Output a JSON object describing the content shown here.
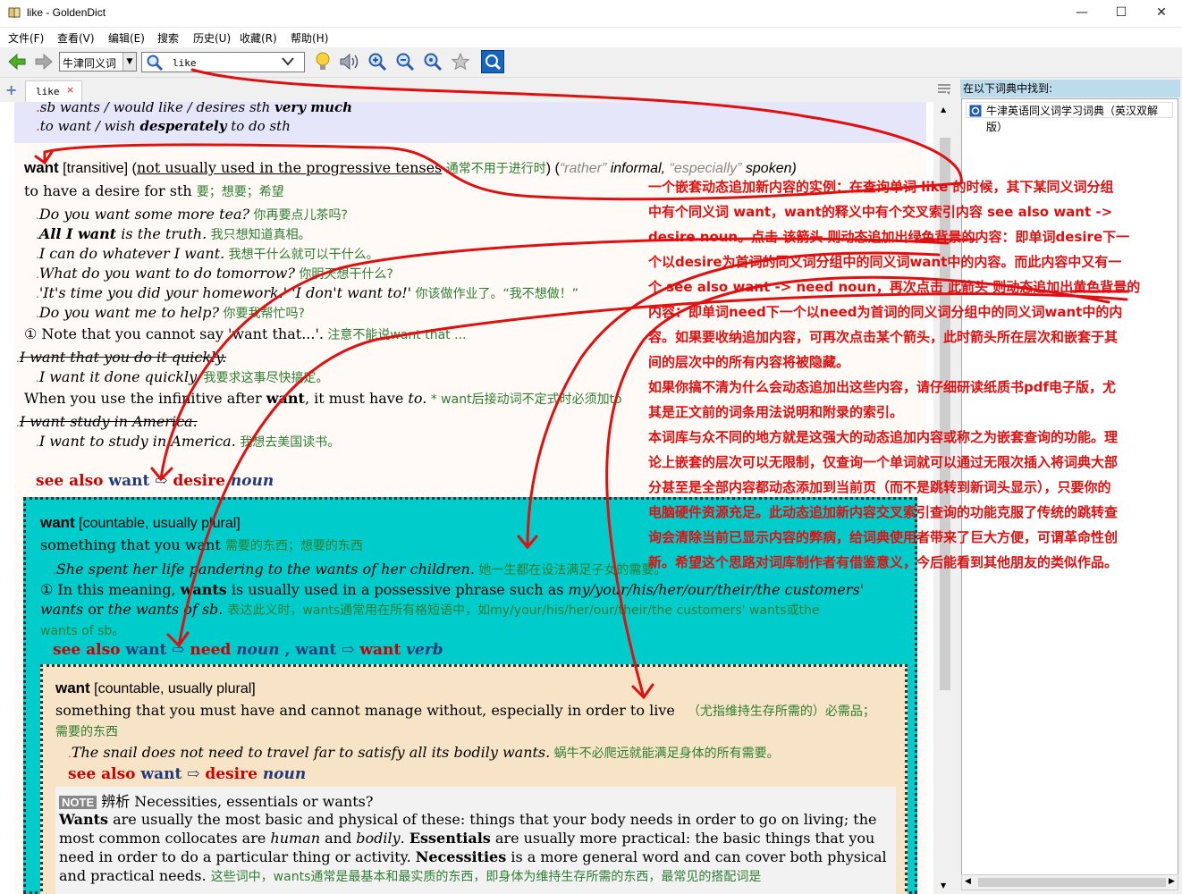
{
  "window": {
    "title": "like - GoldenDict",
    "minimize": "—",
    "maximize": "☐",
    "close": "✕"
  },
  "menu": [
    "文件(F)",
    "查看(V)",
    "编辑(E)",
    "搜索",
    "历史(U)",
    "收藏(R)",
    "帮助(H)"
  ],
  "toolbar": {
    "group": "牛津同义词",
    "query": "like"
  },
  "tab": {
    "label": "like",
    "close": "×"
  },
  "dock": {
    "header": "在以下词典中找到:",
    "dict": "牛津英语同义词学习词典（英汉双解版）"
  },
  "entry": {
    "top1": "sb wants / would like / desires sth ",
    "top1b": "very much",
    "top2": "to want / wish ",
    "top2b": "desperately",
    "top2c": " to do sth",
    "hw": "want",
    "gram": " [transitive] (",
    "gram_u": "not usually used in the progressive tenses",
    "gram_cn": " 通常不用于进行时",
    "gram_tail1": ") (",
    "gram_rather": "“rather”",
    "gram_inf": " informal, ",
    "gram_esp": "“especially”",
    "gram_spoken": " spoken)",
    "def": "to have a desire for sth ",
    "def_cn": "要；想要；希望",
    "ex1": "Do you want some more tea?",
    "ex1_cn": " 你再要点儿茶吗?",
    "ex2a": "All I want",
    "ex2b": " is the truth.",
    "ex2_cn": " 我只想知道真相。",
    "ex3": "I can do whatever I want.",
    "ex3_cn": " 我想干什么就可以干什么。",
    "ex4": "What do you want to do tomorrow?",
    "ex4_cn": " 你明天想干什么?",
    "ex5": "'It's time you did your homework.' 'I don't want to!'",
    "ex5_cn": " 你该做作业了。“我不想做！”",
    "ex6": "Do you want me to help?",
    "ex6_cn": " 你要我帮忙吗?",
    "note1": "① Note that you cannot say 'want that...'.",
    "note1_cn": " 注意不能说want that ...",
    "wrong1": "I want that you do it quickly.",
    "ex7": "I want it done quickly.",
    "ex7_cn": " 我要求这事尽快搞定。",
    "note2a": "When you use the infinitive after ",
    "note2b": "want",
    "note2c": ", it must have ",
    "note2d": "to.",
    "note2_cn": " * want后接动词不定式时必须加to",
    "wrong2": "I want study in America.",
    "ex8": "I want to study in America.",
    "ex8_cn": " 我想去美国读书。",
    "see1a": "see also",
    "see1b": " want ⇨ ",
    "see1c": "desire",
    "see1d": " noun"
  },
  "sub1": {
    "hw": "want",
    "gram": " [countable, usually plural]",
    "def": "something that you want ",
    "def_cn": "需要的东西；想要的东西",
    "ex": "She spent her life pandering to the wants of her children.",
    "ex_cn": " 她一生都在设法满足子女的需要。",
    "note_a": "① In this meaning, ",
    "note_b": "wants",
    "note_c": " is usually used in a possessive phrase such as ",
    "note_d": "my/your/his/her/our/their/the customers'",
    "note2_a": "wants",
    "note2_b": " or ",
    "note2_c": "the wants of sb",
    "note2_d": ". ",
    "note2_cn": "表达此义时，wants通常用在所有格短语中，如my/your/his/her/our/their/the customers' wants或the",
    "note3_cn": "wants of sb。",
    "see_a": "see also",
    "see_b": " want ⇨ ",
    "see_c": "need",
    "see_d": " noun",
    "see_e": " , want ⇨ ",
    "see_f": "want",
    "see_g": " verb"
  },
  "sub2": {
    "hw": "want",
    "gram": " [countable, usually plural]",
    "def": "something that you must have and cannot manage without, especially in order to live",
    "def_cn": "（尤指维持生存所需的）必需品；",
    "def_cn2": "需要的东西",
    "ex": "The snail does not need to travel far to satisfy all its bodily wants.",
    "ex_cn": " 蜗牛不必爬远就能满足身体的所有需要。",
    "see_a": "see also",
    "see_b": " want ⇨ ",
    "see_c": "desire",
    "see_d": " noun",
    "note_tag": "NOTE",
    "note_head": " 辨析 Necessities, essentials or wants?",
    "p1a": "Wants",
    "p1b": " are usually the most basic and physical of these: things that your body needs in order to go on living; the",
    "p2a": "most common collocates are ",
    "p2b": "human",
    "p2c": " and ",
    "p2d": "bodily",
    "p2e": ". ",
    "p2f": "Essentials",
    "p2g": " are usually more practical: the basic things that you",
    "p3a": "need in order to do a particular thing or activity. ",
    "p3b": "Necessities",
    "p3c": " is a more general word and can cover both physical",
    "p4a": "and practical needs. ",
    "p4_cn": "这些词中，wants通常是最基本和最实质的东西，即身体为维持生存所需的东西，最常见的搭配词是"
  },
  "annotation": [
    "一个嵌套动态追加新内容的实例：在查询单词 like 的时候，其下某同义词分组",
    "中有个同义词 want，want的释义中有个交叉索引内容 see also want ->",
    "desire noun。点击 该箭头 则动态追加出绿色背景的内容：即单词desire下一",
    "个以desire为首词的同义词分组中的同义词want中的内容。而此内容中又有一",
    "个 see also want -> need noun，再次点击 此箭头 则动态追加出黄色背景的",
    "内容：即单词need下一个以need为首词的同义词分组中的同义词want中的内",
    "容。如果要收纳追加内容，可再次点击某个箭头，此时箭头所在层次和嵌套于其",
    "间的层次中的所有内容将被隐藏。",
    "如果你搞不清为什么会动态追加出这些内容，请仔细研读纸质书pdf电子版，尤",
    "其是正文前的词条用法说明和附录的索引。",
    "本词库与众不同的地方就是这强大的动态追加内容或称之为嵌套查询的功能。理",
    "论上嵌套的层次可以无限制，仅查询一个单词就可以通过无限次插入将词典大部",
    "分甚至是全部内容都动态添加到当前页（而不是跳转到新词头显示），只要你的",
    "电脑硬件资源充足。此动态追加新内容交叉索引查询的功能克服了传统的跳转查",
    "询会清除当前已显示内容的弊病，给词典使用者带来了巨大方便，可谓革命性创",
    "新。希望这个思路对词库制作者有借鉴意义，今后能看到其他朋友的类似作品。"
  ],
  "colors": {
    "cyan": "#00cccc",
    "yellow": "#f7e4c6",
    "annot": "#e01010",
    "lavender": "#e6e6fa"
  }
}
